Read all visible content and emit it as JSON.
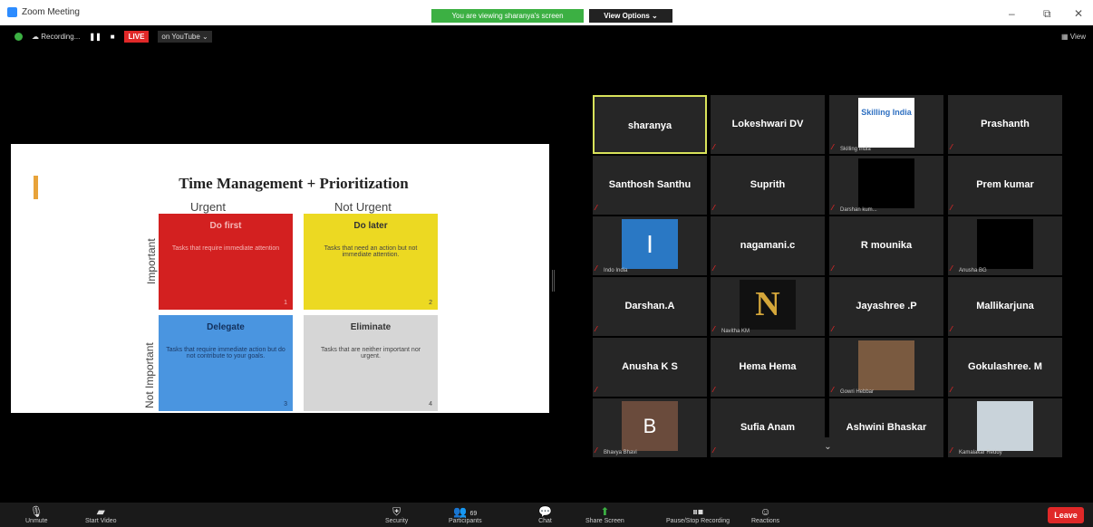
{
  "window": {
    "title": "Zoom Meeting",
    "share_banner": "You are viewing sharanya's screen",
    "view_options": "View Options ⌄"
  },
  "status": {
    "recording": "Recording...",
    "live": "LIVE",
    "youtube": "on YouTube ⌄",
    "view": "View"
  },
  "slide": {
    "title": "Time Management + Prioritization",
    "col_urgent": "Urgent",
    "col_not_urgent": "Not Urgent",
    "row_important": "Important",
    "row_not_important": "Not Important",
    "quadrants": [
      {
        "title": "Do first",
        "text": "Tasks that require immediate attention",
        "num": "1"
      },
      {
        "title": "Do later",
        "text": "Tasks that need an action but not immediate attention.",
        "num": "2"
      },
      {
        "title": "Delegate",
        "text": "Tasks that require immediate action but do not contribute to your goals.",
        "num": "3"
      },
      {
        "title": "Eliminate",
        "text": "Tasks that are neither important nor urgent.",
        "num": "4"
      }
    ]
  },
  "participants": [
    {
      "name": "sharanya"
    },
    {
      "name": "Lokeshwari DV"
    },
    {
      "name": "",
      "tag": "Skilling India"
    },
    {
      "name": "Prashanth"
    },
    {
      "name": "Santhosh Santhu"
    },
    {
      "name": "Suprith"
    },
    {
      "name": "",
      "tag": "Darshan kum..."
    },
    {
      "name": "Prem kumar"
    },
    {
      "name": "",
      "tag": "Indo India"
    },
    {
      "name": "nagamani.c"
    },
    {
      "name": "R mounika"
    },
    {
      "name": "",
      "tag": "Anusha BG"
    },
    {
      "name": "Darshan.A"
    },
    {
      "name": "",
      "tag": "Navitha KM"
    },
    {
      "name": "Jayashree .P"
    },
    {
      "name": "Mallikarjuna"
    },
    {
      "name": "Anusha K S"
    },
    {
      "name": "Hema Hema"
    },
    {
      "name": "",
      "tag": "Gowri Hebbar"
    },
    {
      "name": "Gokulashree. M"
    },
    {
      "name": "",
      "tag": "Bhavya Bhavi"
    },
    {
      "name": "Sufia Anam"
    },
    {
      "name": "Ashwini Bhaskar"
    },
    {
      "name": "",
      "tag": "Kamalakar Reddy"
    }
  ],
  "skilling_logo": "Skilling India",
  "avatar_I": "I",
  "avatar_N": "N",
  "avatar_B": "B",
  "toolbar": {
    "unmute": "Unmute",
    "start_video": "Start Video",
    "security": "Security",
    "participants": "Participants",
    "participants_count": "69",
    "chat": "Chat",
    "share_screen": "Share Screen",
    "record": "Pause/Stop Recording",
    "reactions": "Reactions",
    "leave": "Leave"
  }
}
